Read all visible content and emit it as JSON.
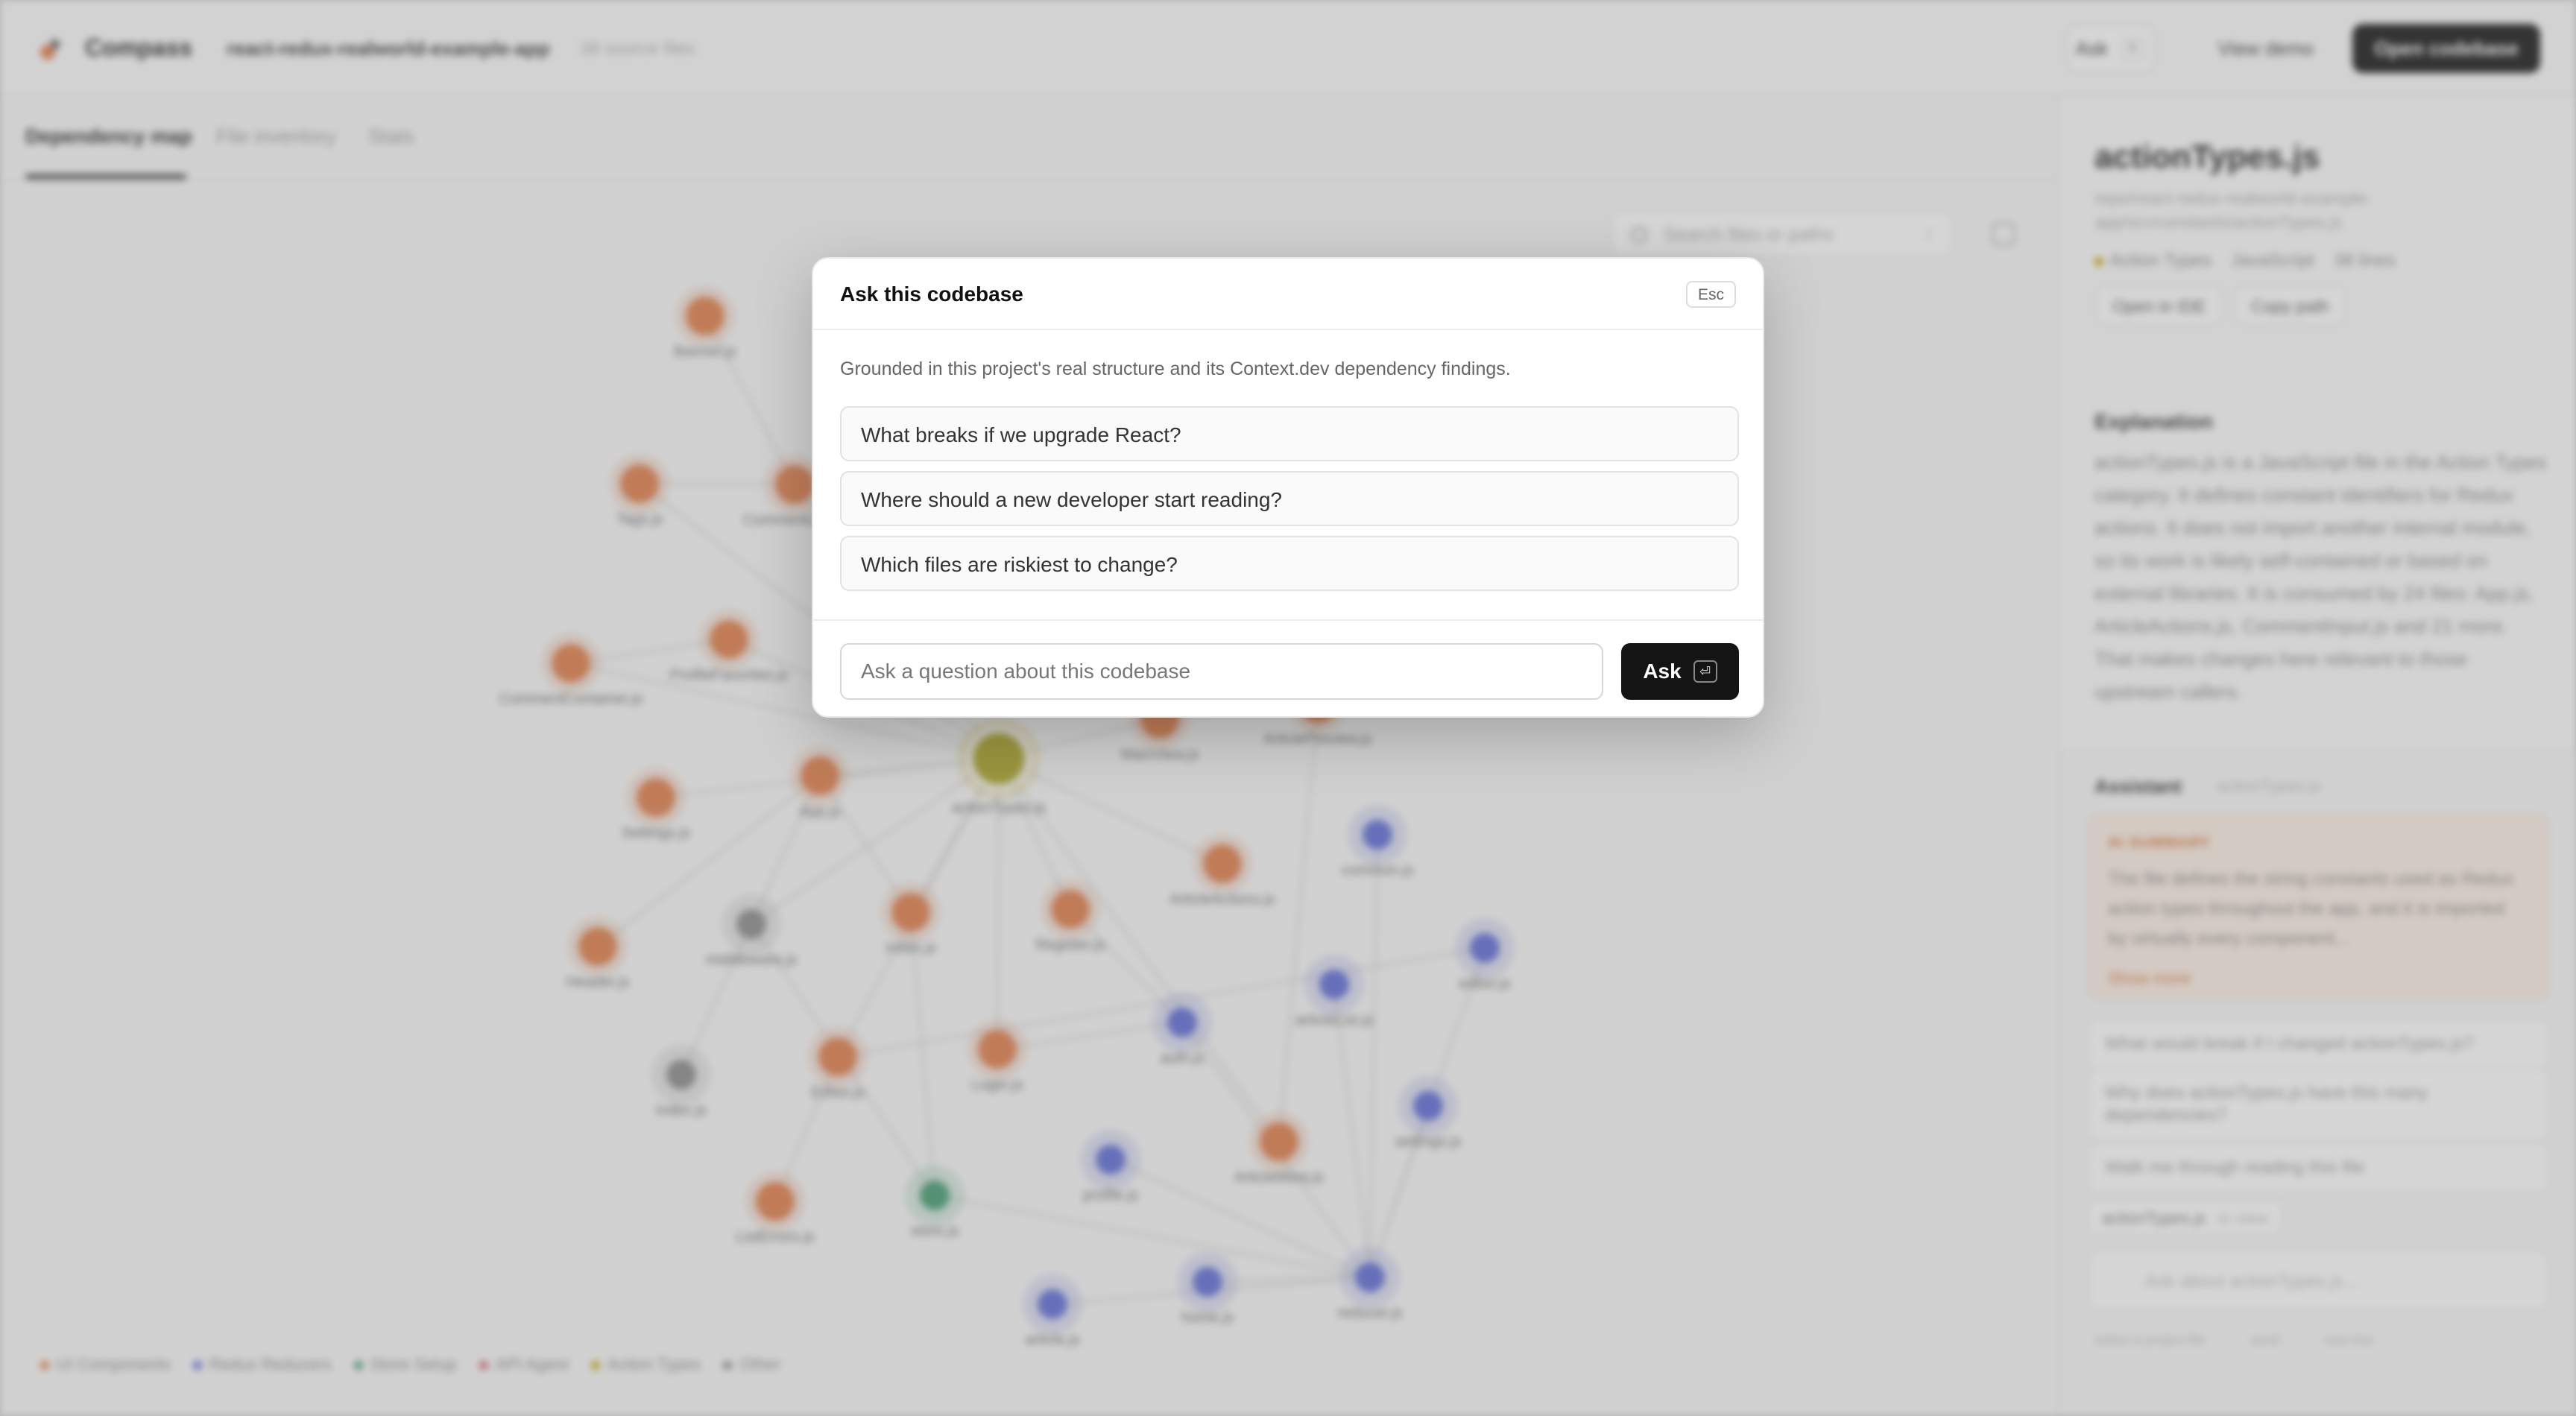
{
  "app": {
    "brand": "Compass",
    "repo_name": "react-redux-realworld-example-app",
    "file_count": "38 source files",
    "header_buttons": {
      "ask_label": "Ask",
      "ask_shortcut": "K",
      "view_demo_label": "View demo",
      "open_codebase_label": "Open codebase"
    },
    "tabs": [
      {
        "label": "Dependency map",
        "active": true
      },
      {
        "label": "File inventory",
        "active": false
      },
      {
        "label": "Stats",
        "active": false
      }
    ],
    "search": {
      "placeholder": "Search files or paths",
      "shortcut": "/"
    }
  },
  "graph": {
    "highlight_color": "#a9a01f",
    "nodes": [
      {
        "label": "Banner.js",
        "kind": "ui"
      },
      {
        "label": "Tags.js",
        "kind": "ui"
      },
      {
        "label": "CommentList.js",
        "kind": "ui"
      },
      {
        "label": "ProfileFavorites.js",
        "kind": "ui"
      },
      {
        "label": "CommentContainer.js",
        "kind": "ui"
      },
      {
        "label": "App.js",
        "kind": "ui"
      },
      {
        "label": "actionTypes.js",
        "kind": "action"
      },
      {
        "label": "MainView.js",
        "kind": "ui"
      },
      {
        "label": "ArticlePreview.js",
        "kind": "ui"
      },
      {
        "label": "Settings.js",
        "kind": "ui"
      },
      {
        "label": "ArticleActions.js",
        "kind": "ui"
      },
      {
        "label": "common.js",
        "kind": "reducer"
      },
      {
        "label": "Header.js",
        "kind": "ui"
      },
      {
        "label": "middleware.js",
        "kind": "other"
      },
      {
        "label": "index.js",
        "kind": "ui"
      },
      {
        "label": "Register.js",
        "kind": "ui"
      },
      {
        "label": "editor.js",
        "kind": "reducer"
      },
      {
        "label": "articleList.js",
        "kind": "reducer"
      },
      {
        "label": "auth.js",
        "kind": "reducer"
      },
      {
        "label": "index.js",
        "kind": "other"
      },
      {
        "label": "Editor.js",
        "kind": "ui"
      },
      {
        "label": "Login.js",
        "kind": "ui"
      },
      {
        "label": "settings.js",
        "kind": "reducer"
      },
      {
        "label": "profile.js",
        "kind": "reducer"
      },
      {
        "label": "ArticleMeta.js",
        "kind": "ui"
      },
      {
        "label": "ListErrors.js",
        "kind": "ui"
      },
      {
        "label": "store.js",
        "kind": "store"
      },
      {
        "label": "article.js",
        "kind": "reducer"
      },
      {
        "label": "home.js",
        "kind": "reducer"
      },
      {
        "label": "reducer.js",
        "kind": "reducer"
      }
    ],
    "legend": [
      {
        "label": "UI Components",
        "color": "#e07b45"
      },
      {
        "label": "Redux Reducers",
        "color": "#5b69d6"
      },
      {
        "label": "Store Setup",
        "color": "#3e9a6c"
      },
      {
        "label": "API Agent",
        "color": "#d45a6a"
      },
      {
        "label": "Action Types",
        "color": "#c4a400"
      },
      {
        "label": "Other",
        "color": "#888888"
      }
    ]
  },
  "sidebar": {
    "file_title": "actionTypes.js",
    "file_path": "repo/react-redux-realworld-example-app/src/constants/actionTypes.js",
    "category": "Action Types",
    "language": "JavaScript",
    "lines": "38 lines",
    "open_ide_label": "Open in IDE",
    "copy_path_label": "Copy path",
    "explanation_title": "Explanation",
    "explanation_body": "actionTypes.js is a JavaScript file in the Action Types category. It defines constant identifiers for Redux actions. It does not import another internal module, so its work is likely self-contained or based on external libraries. It is consumed by 24 files: App.js, ArticleActions.js, CommentInput.js and 21 more. That makes changes here relevant to those upstream callers.",
    "assistant": {
      "title": "Assistant",
      "subtitle": "actionTypes.js",
      "summary_label": "AI SUMMARY",
      "summary_text": "The file defines the string constants used as Redux action types throughout the app, and it is imported by virtually every component...",
      "show_more": "Show more",
      "questions": [
        "What would break if I changed actionTypes.js?",
        "Why does actionTypes.js have this many dependencies?",
        "Walk me through reading this file"
      ],
      "context_chip": "actionTypes.js",
      "context_chip_sub": "in view",
      "input_placeholder": "Ask about actionTypes.js...",
      "footer": [
        "select a project file",
        "send",
        "new line"
      ]
    }
  },
  "modal": {
    "title": "Ask this codebase",
    "close_label": "Esc",
    "description": "Grounded in this project's real structure and its Context.dev dependency findings.",
    "suggestions": [
      "What breaks if we upgrade React?",
      "Where should a new developer start reading?",
      "Which files are riskiest to change?"
    ],
    "input_placeholder": "Ask a question about this codebase",
    "ask_label": "Ask",
    "enter_glyph": "⏎"
  }
}
